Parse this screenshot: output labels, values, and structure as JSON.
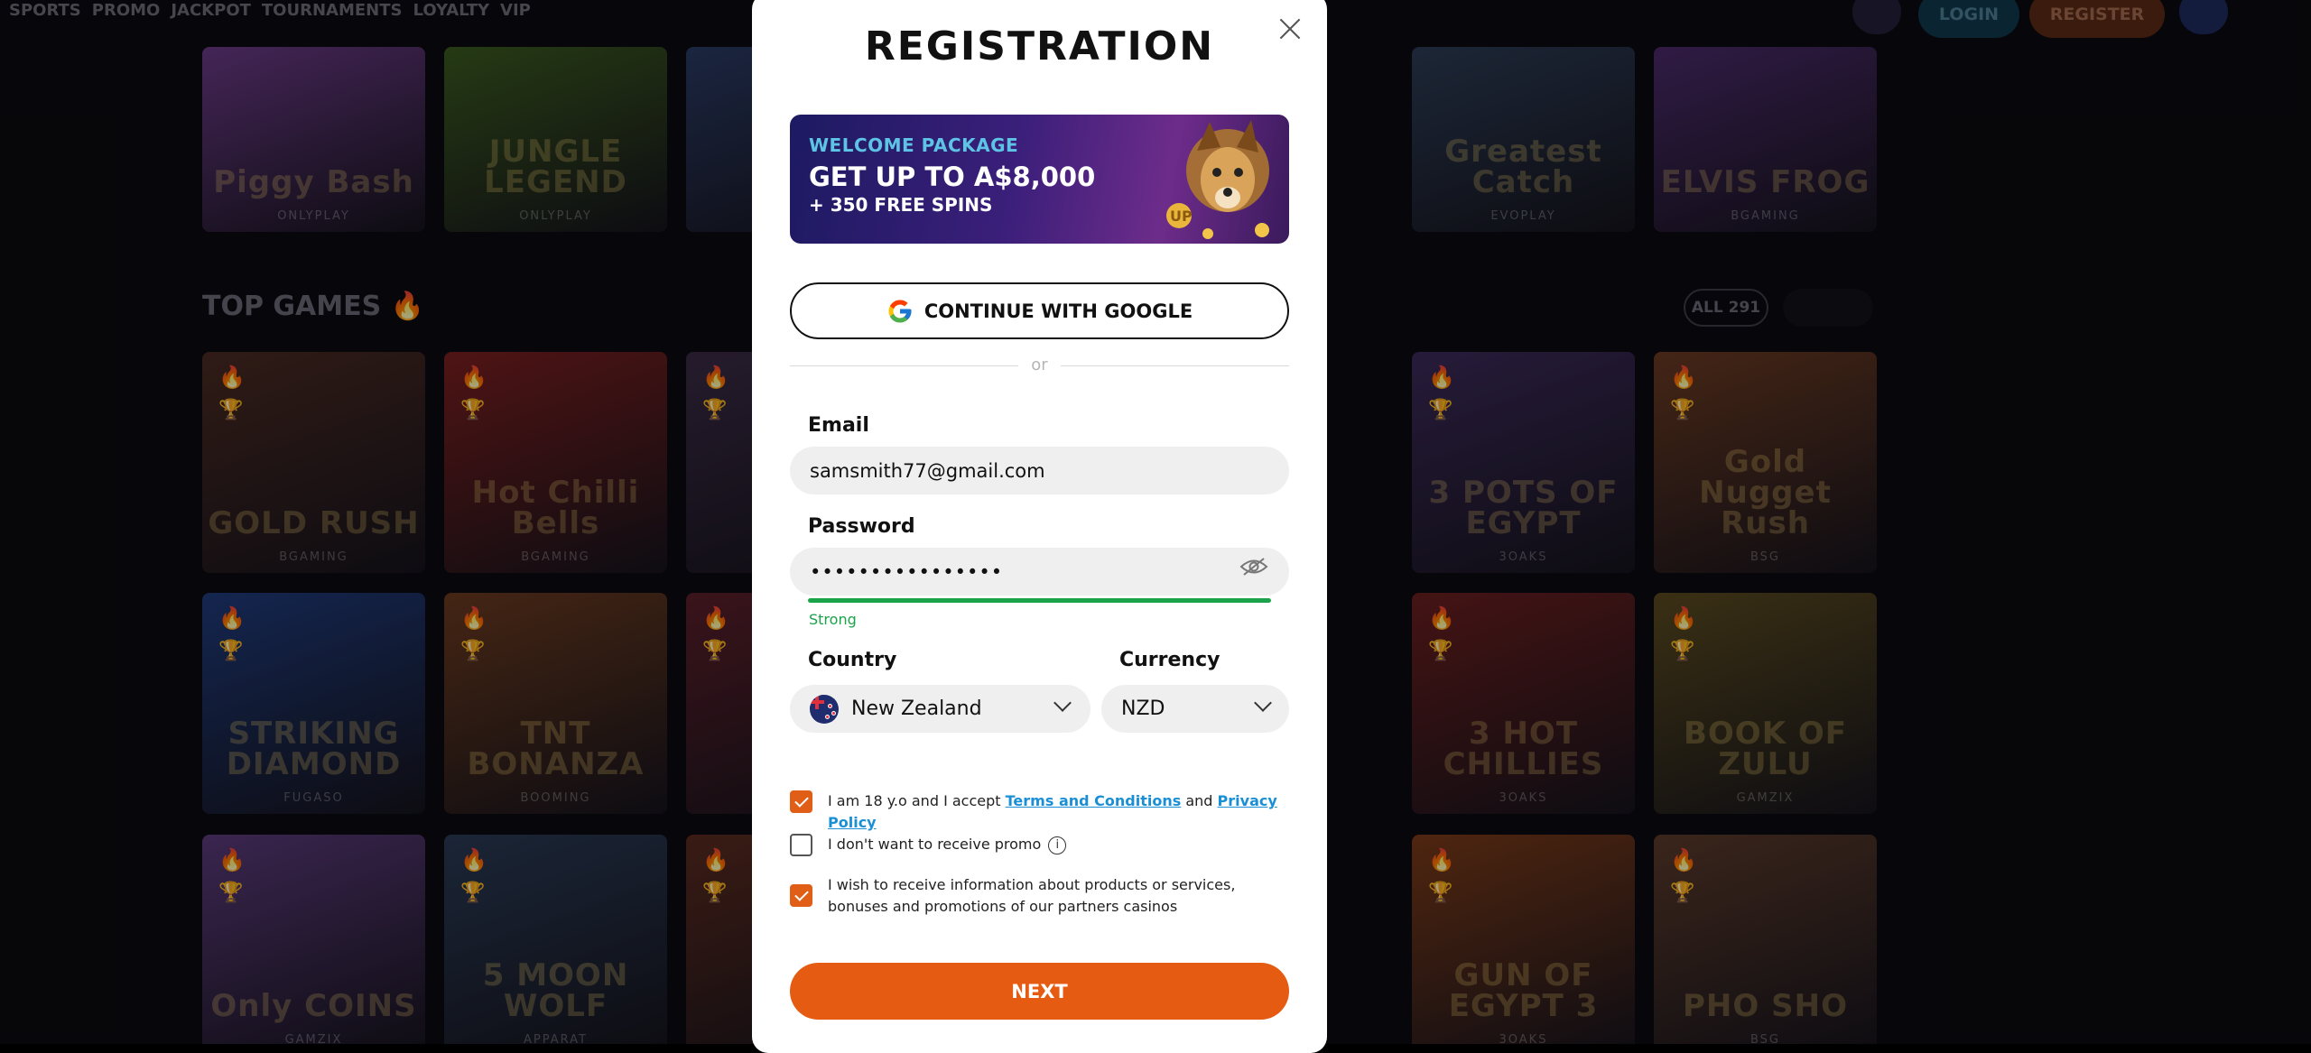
{
  "nav": {
    "items": [
      "SPORTS",
      "PROMO",
      "JACKPOT",
      "TOURNAMENTS",
      "LOYALTY",
      "VIP"
    ],
    "login_label": "LOGIN",
    "register_label": "REGISTER"
  },
  "background": {
    "section_title": "TOP GAMES 🔥",
    "all_label": "ALL 291",
    "top_row": [
      {
        "name": "Piggy Bash",
        "provider": "ONLYPLAY",
        "color": "#6a3a86"
      },
      {
        "name": "JUNGLE LEGEND",
        "provider": "ONLYPLAY",
        "color": "#3b5a1f"
      },
      {
        "name": "",
        "provider": "",
        "color": "#2a3a63"
      },
      {
        "name": "",
        "provider": "",
        "color": "#4a3a1a"
      },
      {
        "name": "Greatest Catch",
        "provider": "EVOPLAY",
        "color": "#2c3c55"
      },
      {
        "name": "ELVIS FROG",
        "provider": "BGAMING",
        "color": "#4b2a6a"
      }
    ],
    "rows": [
      [
        {
          "name": "GOLD RUSH",
          "provider": "BGAMING",
          "color": "#4a2a22"
        },
        {
          "name": "Hot Chilli Bells",
          "provider": "BGAMING",
          "color": "#7a1f1f"
        },
        {
          "name": "",
          "provider": "",
          "color": "#3a2a45"
        },
        {
          "name": "",
          "provider": "",
          "color": "#5a2a55"
        },
        {
          "name": "3 POTS OF EGYPT",
          "provider": "3OAKS",
          "color": "#3c2a5a"
        },
        {
          "name": "Gold Nugget Rush",
          "provider": "BSG",
          "color": "#6a3a22"
        }
      ],
      [
        {
          "name": "STRIKING DIAMOND",
          "provider": "FUGASO",
          "color": "#1f3a7a"
        },
        {
          "name": "TNT BONANZA",
          "provider": "BOOMING",
          "color": "#6a3a1f"
        },
        {
          "name": "",
          "provider": "",
          "color": "#5a1f2a"
        },
        {
          "name": "",
          "provider": "",
          "color": "#2a3a5a"
        },
        {
          "name": "3 HOT CHILLIES",
          "provider": "3OAKS",
          "color": "#6a1f1f"
        },
        {
          "name": "BOOK OF ZULU",
          "provider": "GAMZIX",
          "color": "#5a4a1f"
        }
      ],
      [
        {
          "name": "Only COINS",
          "provider": "GAMZIX",
          "color": "#5a3a7a"
        },
        {
          "name": "5 MOON WOLF",
          "provider": "APPARAT",
          "color": "#2a3a55"
        },
        {
          "name": "",
          "provider": "",
          "color": "#5a2a1f"
        },
        {
          "name": "",
          "provider": "",
          "color": "#3a3a3a"
        },
        {
          "name": "GUN OF EGYPT 3",
          "provider": "3OAKS",
          "color": "#7a3a1a"
        },
        {
          "name": "PHO SHO",
          "provider": "BSG",
          "color": "#5a3a2a"
        }
      ]
    ]
  },
  "modal": {
    "title": "REGISTRATION",
    "banner": {
      "kicker": "WELCOME PACKAGE",
      "headline": "GET UP TO A$8,000",
      "sub": "+ 350 FREE SPINS"
    },
    "google_label": "CONTINUE WITH GOOGLE",
    "or_label": "or",
    "email_label": "Email",
    "email_value": "samsmith77@gmail.com",
    "password_label": "Password",
    "password_value": "••••••••••••••••",
    "strength_label": "Strong",
    "strength_level": 1.0,
    "country_label": "Country",
    "country_value": "New Zealand",
    "currency_label": "Currency",
    "currency_value": "NZD",
    "checks": {
      "age_prefix": "I am 18 y.o and I accept",
      "terms_link": "Terms and Conditions",
      "and_word": "and",
      "privacy_link": "Privacy Policy",
      "promo_text": "I don't want to receive promo",
      "partners_line1": "I wish to receive information about products or services,",
      "partners_line2": "bonuses and promotions of our partners casinos"
    },
    "next_label": "NEXT"
  },
  "colors": {
    "accent": "#e55b11",
    "link": "#1b8fd6",
    "strong": "#1aa34a"
  }
}
